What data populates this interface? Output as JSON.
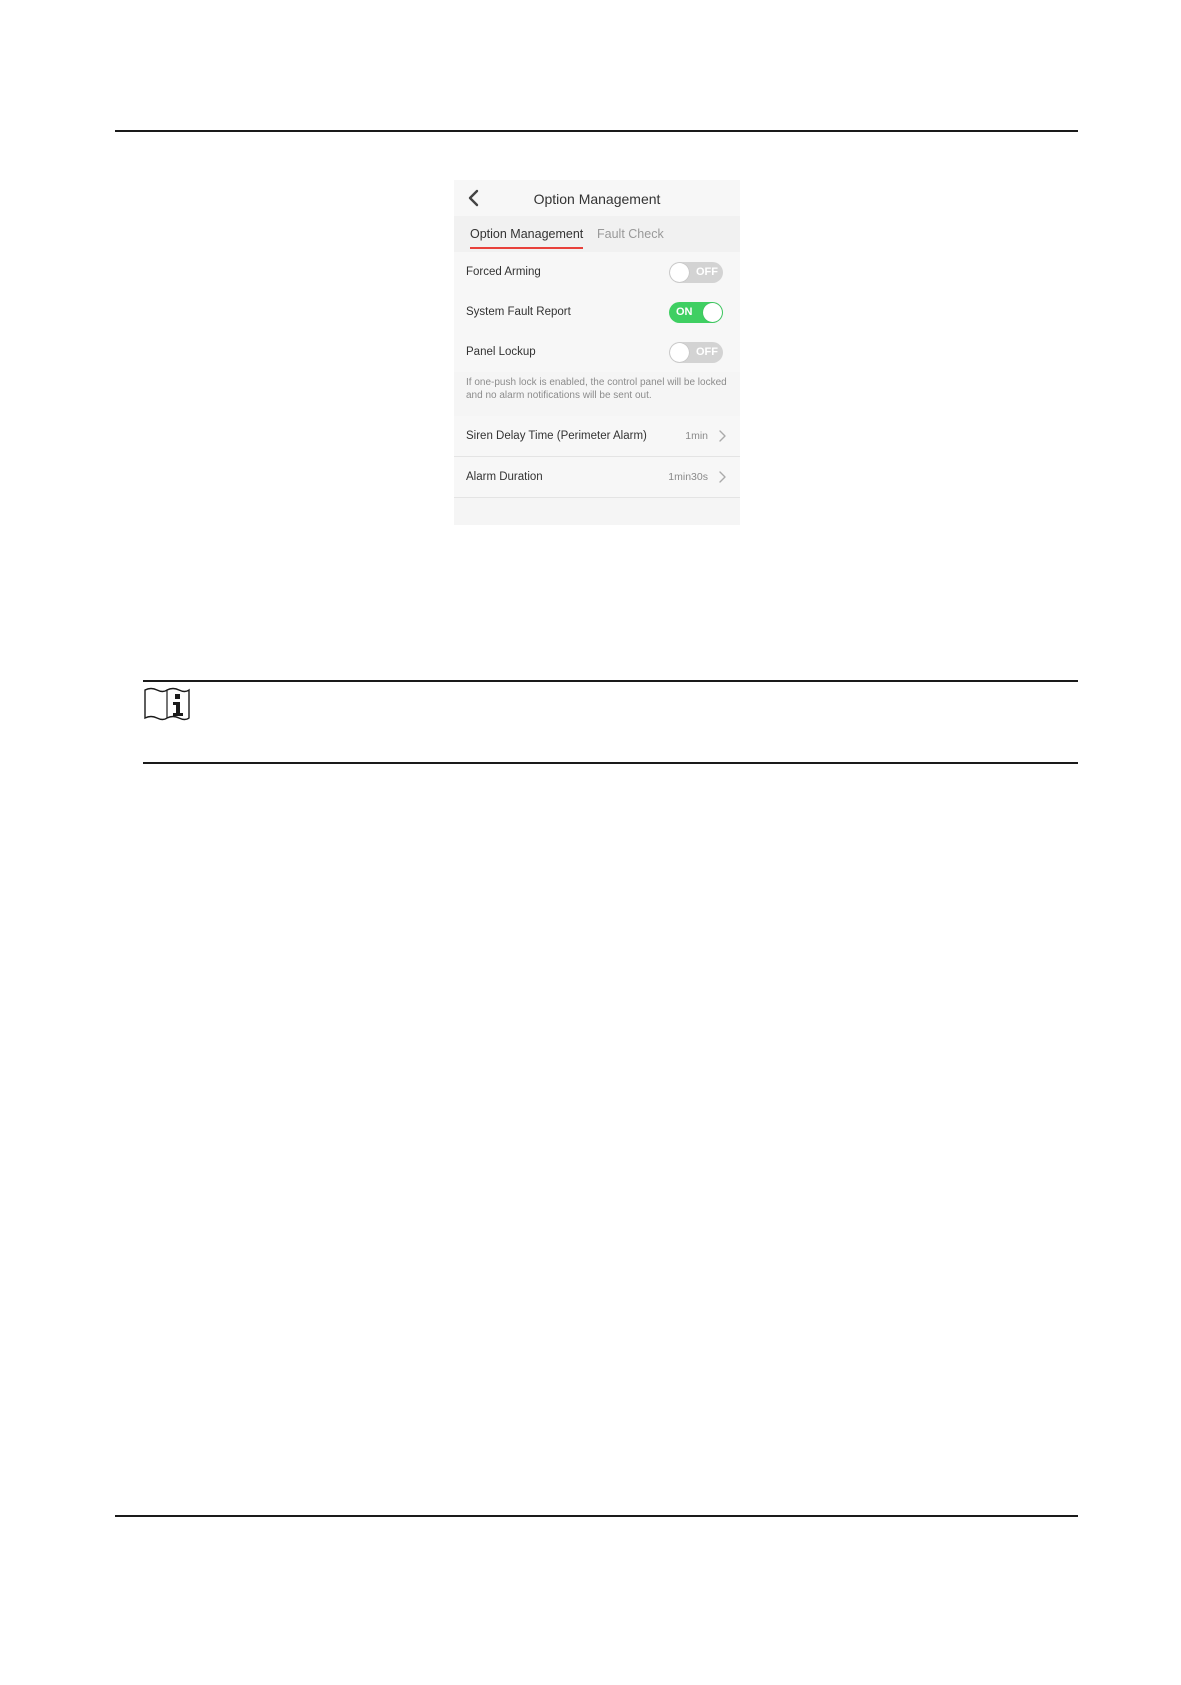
{
  "screen": {
    "title": "Option Management",
    "tabs": [
      {
        "label": "Option Management",
        "active": true
      },
      {
        "label": "Fault Check",
        "active": false
      }
    ],
    "toggles": [
      {
        "label": "Forced Arming",
        "state": "OFF"
      },
      {
        "label": "System Fault Report",
        "state": "ON"
      },
      {
        "label": "Panel Lockup",
        "state": "OFF"
      }
    ],
    "lock_hint": "If one-push lock is enabled, the control panel will be locked and no alarm notifications will be sent out.",
    "settings": [
      {
        "label": "Siren Delay Time (Perimeter Alarm)",
        "value": "1min"
      },
      {
        "label": "Alarm Duration",
        "value": "1min30s"
      }
    ]
  },
  "icons": {
    "back": "chevron-left-icon",
    "row_arrow": "chevron-right-icon",
    "note": "info-book-icon"
  },
  "colors": {
    "accent": "#e8413b",
    "toggle_on": "#3fcf62",
    "toggle_off": "#d3d3d3"
  }
}
